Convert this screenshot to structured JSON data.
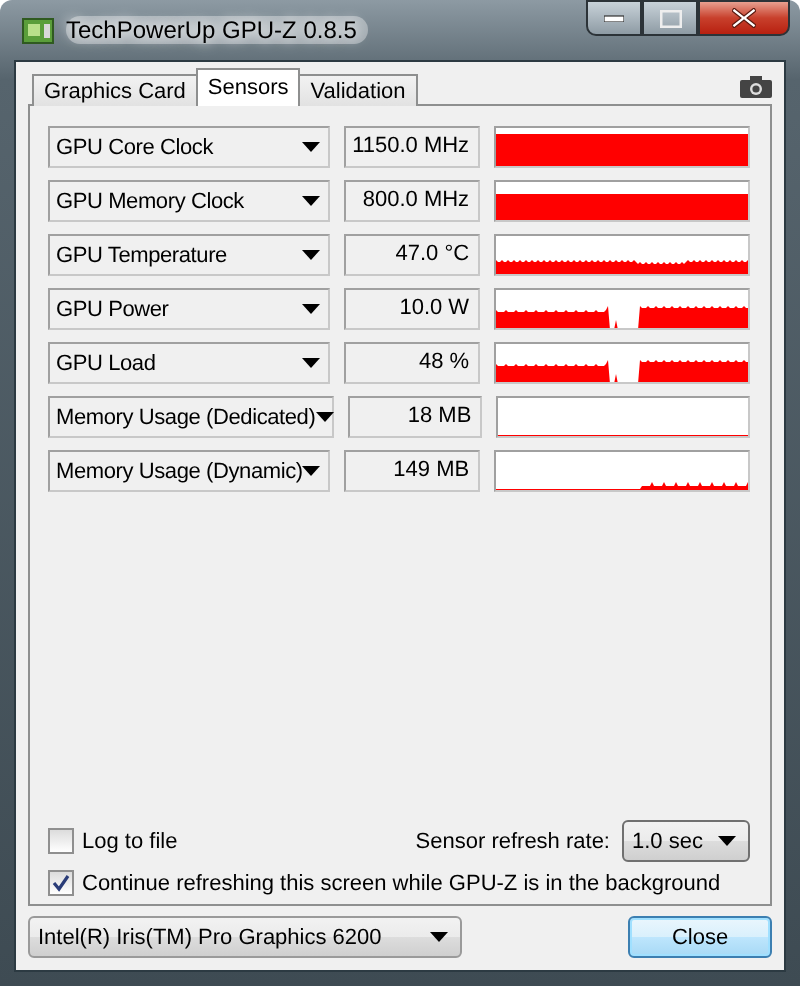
{
  "window": {
    "title": "TechPowerUp GPU-Z 0.8.5"
  },
  "tabs": [
    {
      "label": "Graphics Card",
      "selected": false
    },
    {
      "label": "Sensors",
      "selected": true
    },
    {
      "label": "Validation",
      "selected": false
    }
  ],
  "sensors": [
    {
      "name": "GPU Core Clock",
      "value": "1150.0 MHz",
      "kind": "full"
    },
    {
      "name": "GPU Memory Clock",
      "value": "800.0 MHz",
      "kind": "high"
    },
    {
      "name": "GPU Temperature",
      "value": "47.0 °C",
      "kind": "low"
    },
    {
      "name": "GPU Power",
      "value": "10.0 W",
      "kind": "dip"
    },
    {
      "name": "GPU Load",
      "value": "48 %",
      "kind": "dip"
    },
    {
      "name": "Memory Usage (Dedicated)",
      "value": "18 MB",
      "kind": "flat"
    },
    {
      "name": "Memory Usage (Dynamic)",
      "value": "149 MB",
      "kind": "tail"
    }
  ],
  "log_to_file": {
    "label": "Log to file",
    "checked": false
  },
  "refresh_rate": {
    "label": "Sensor refresh rate:",
    "value": "1.0 sec"
  },
  "continue_refreshing": {
    "label": "Continue refreshing this screen while GPU-Z is in the background",
    "checked": true
  },
  "gpu_select": {
    "value": "Intel(R) Iris(TM) Pro Graphics 6200"
  },
  "close_button": "Close"
}
